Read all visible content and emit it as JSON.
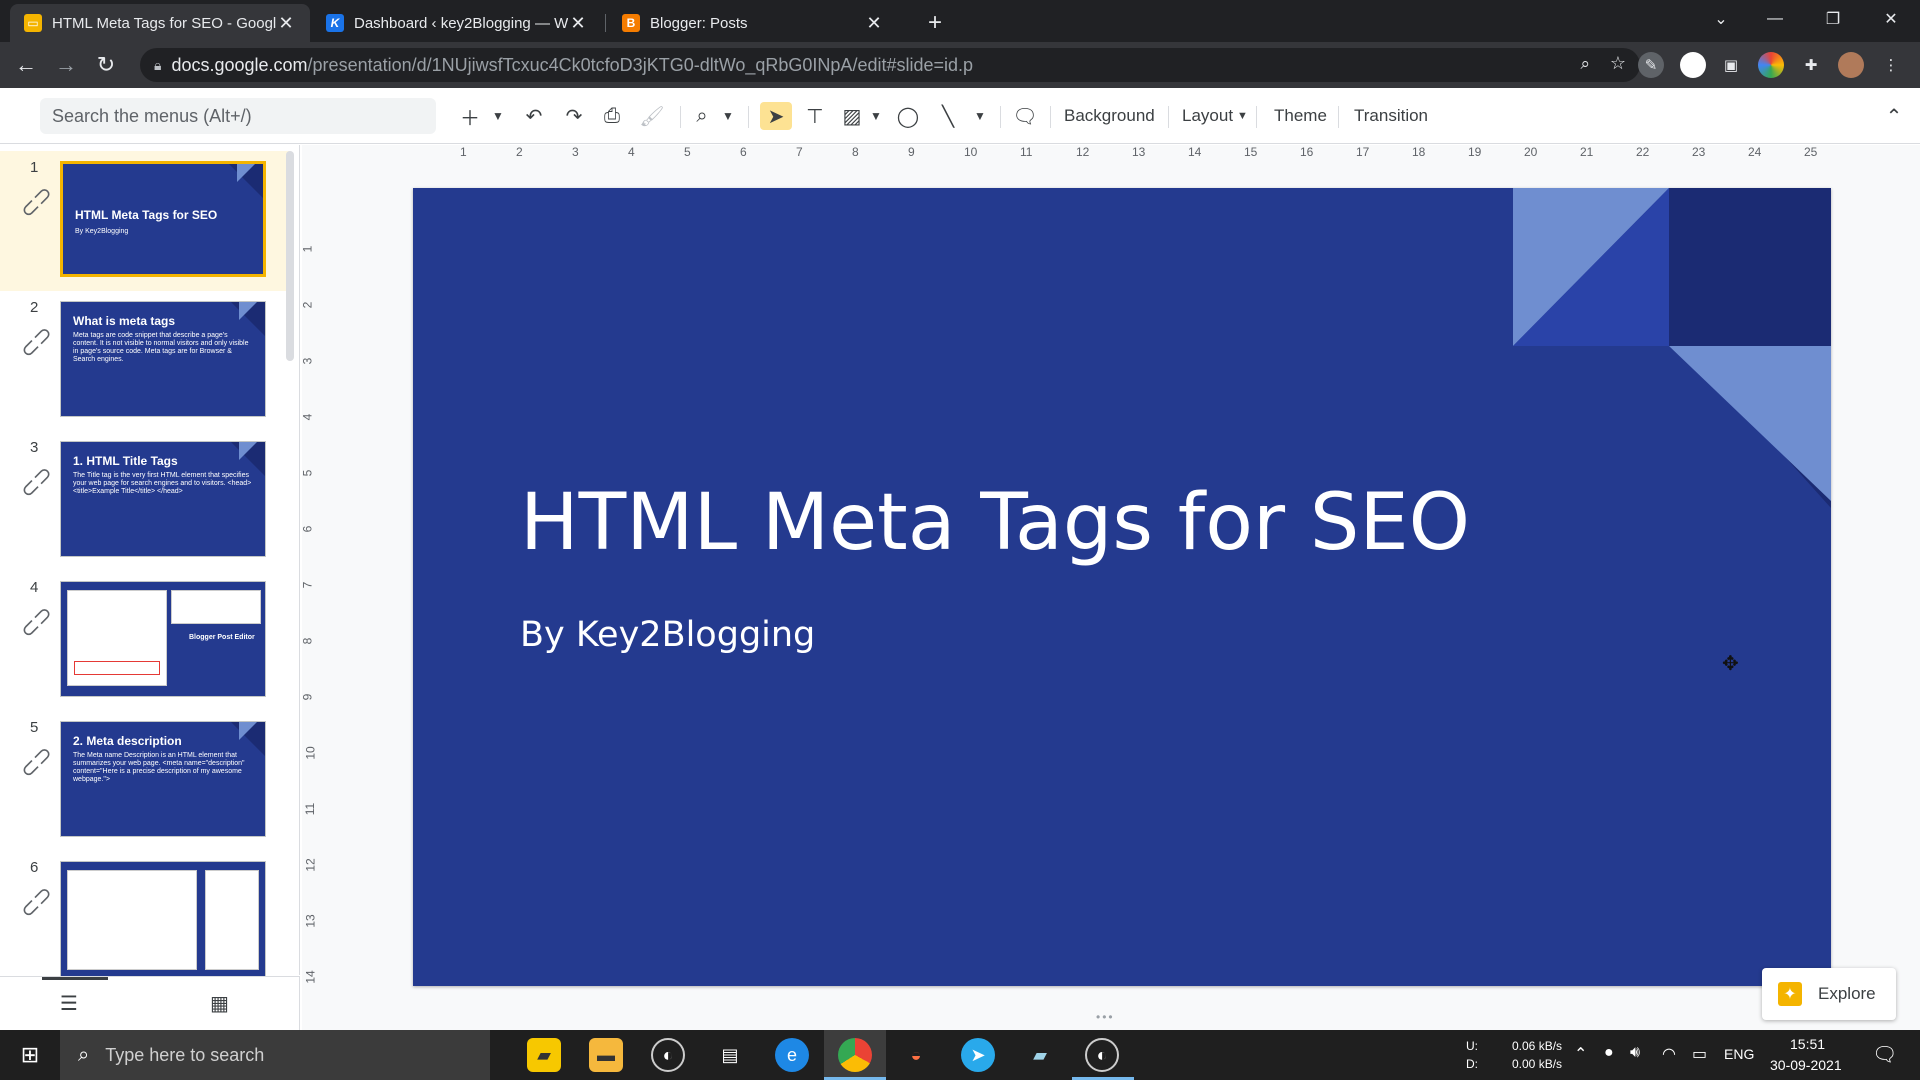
{
  "browser": {
    "tabs": [
      {
        "title": "HTML Meta Tags for SEO - Googl",
        "favicon": "slides-icon",
        "favicon_color": "#f4b400",
        "active": true
      },
      {
        "title": "Dashboard ‹ key2Blogging — W",
        "favicon": "k-icon",
        "favicon_color": "#1a73e8",
        "active": false
      },
      {
        "title": "Blogger: Posts",
        "favicon": "blogger-icon",
        "favicon_color": "#f57c00",
        "active": false
      }
    ],
    "new_tab": "+",
    "url_host": "docs.google.com",
    "url_path": "/presentation/d/1NUjiwsfTcxuc4Ck0tcfoD3jKTG0-dltWo_qRbG0INpA/edit#slide=id.p"
  },
  "slides_toolbar": {
    "search_placeholder": "Search the menus (Alt+/)",
    "background": "Background",
    "layout": "Layout",
    "theme": "Theme",
    "transition": "Transition"
  },
  "filmstrip": {
    "slides": [
      {
        "num": "1",
        "title": "HTML Meta Tags for SEO",
        "body": "By Key2Blogging"
      },
      {
        "num": "2",
        "title": "What is meta tags",
        "body": "Meta tags are code snippet that describe a page's content. It is not visible to normal visitors and only visible in page's source code. Meta tags are for Browser & Search engines."
      },
      {
        "num": "3",
        "title": "1. HTML Title Tags",
        "body": "The Title tag is the very first HTML element that specifies your web page for search engines and to visitors. <head> <title>Example Title</title> </head>"
      },
      {
        "num": "4",
        "title": "",
        "body": "Blogger Post Editor"
      },
      {
        "num": "5",
        "title": "2. Meta description",
        "body": "The Meta name Description is an HTML element that summarizes your web page. <meta name=\"description\" content=\"Here is a precise description of my awesome webpage.\">"
      },
      {
        "num": "6",
        "title": "",
        "body": ""
      }
    ]
  },
  "ruler": {
    "h": [
      "1",
      "2",
      "3",
      "4",
      "5",
      "6",
      "7",
      "8",
      "9",
      "10",
      "11",
      "12",
      "13",
      "14",
      "15",
      "16",
      "17",
      "18",
      "19",
      "20",
      "21",
      "22",
      "23",
      "24",
      "25"
    ],
    "v": [
      "1",
      "2",
      "3",
      "4",
      "5",
      "6",
      "7",
      "8",
      "9",
      "10",
      "11",
      "12",
      "13",
      "14"
    ]
  },
  "slide": {
    "title": "HTML Meta Tags for SEO",
    "subtitle": "By Key2Blogging",
    "bg_color": "#243a8f"
  },
  "explore_label": "Explore",
  "taskbar": {
    "search_placeholder": "Type here to search",
    "net_up_label": "U:",
    "net_down_label": "D:",
    "net_up": "0.06 kB/s",
    "net_down": "0.00 kB/s",
    "lang": "ENG",
    "time": "15:51",
    "date": "30-09-2021"
  }
}
